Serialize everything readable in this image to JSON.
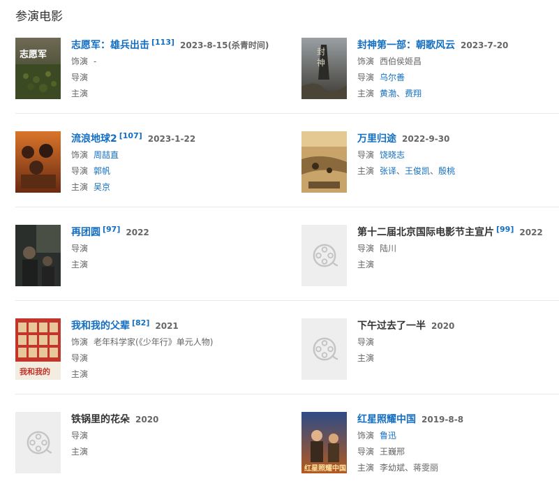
{
  "section_title": "参演电影",
  "labels": {
    "role": "饰演",
    "director": "导演",
    "star": "主演"
  },
  "movies": [
    {
      "title": "志愿军：雄兵出击",
      "ref": "[113]",
      "date": "2023-8-15(杀青时间)",
      "role": "-",
      "director": "",
      "stars": []
    },
    {
      "title": "封神第一部：朝歌风云",
      "ref": "",
      "date": "2023-7-20",
      "role": "西伯侯姬昌",
      "director": "乌尔善",
      "stars": [
        "黄渤",
        "费翔"
      ]
    },
    {
      "title": "流浪地球2",
      "ref": "[107]",
      "date": "2023-1-22",
      "role": "周喆直",
      "director": "郭帆",
      "stars": [
        "吴京"
      ]
    },
    {
      "title": "万里归途",
      "ref": "",
      "date": "2022-9-30",
      "director": "饶晓志",
      "stars": [
        "张译",
        "王俊凯",
        "殷桃"
      ]
    },
    {
      "title": "再团圆",
      "ref": "[97]",
      "date": "2022",
      "director": "",
      "stars": []
    },
    {
      "title": "第十二届北京国际电影节主宣片",
      "ref": "[99]",
      "date": "2022",
      "director": "陆川",
      "stars": []
    },
    {
      "title": "我和我的父辈",
      "ref": "[82]",
      "date": "2021",
      "role": "老年科学家(《少年行》单元人物)",
      "director": "",
      "stars": []
    },
    {
      "title": "下午过去了一半",
      "ref": "",
      "date": "2020",
      "director": "",
      "stars": []
    },
    {
      "title": "铁锅里的花朵",
      "ref": "",
      "date": "2020",
      "director": "",
      "stars": []
    },
    {
      "title": "红星照耀中国",
      "ref": "",
      "date": "2019-8-8",
      "role": "鲁迅",
      "director": "王巍邢",
      "stars": [
        "李幼斌",
        "蒋雯丽"
      ]
    }
  ]
}
